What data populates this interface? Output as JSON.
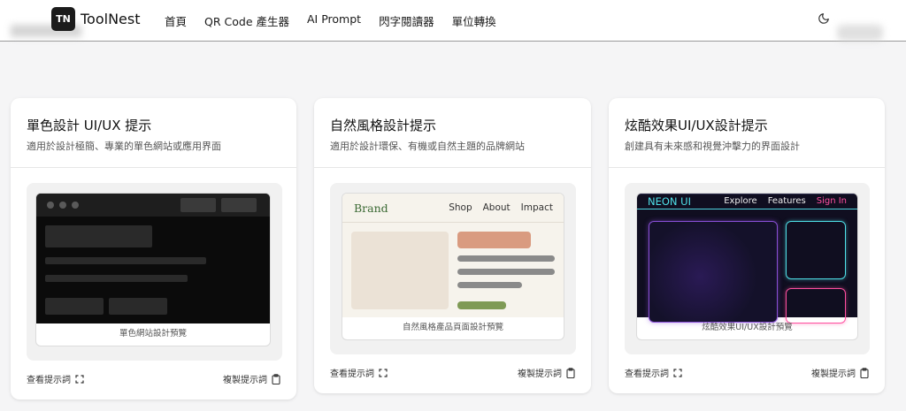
{
  "header": {
    "logo_initials": "TN",
    "app_name": "ToolNest",
    "nav": [
      "首頁",
      "QR Code 產生器",
      "AI Prompt",
      "閃字閱讀器",
      "單位轉換"
    ],
    "theme_icon": "moon-icon"
  },
  "cards": [
    {
      "title": "單色設計 UI/UX 提示",
      "description": "適用於設計極簡、專業的單色網站或應用界面",
      "preview_caption": "單色網站設計預覽",
      "view_label": "查看提示詞",
      "copy_label": "複製提示詞"
    },
    {
      "title": "自然風格設計提示",
      "description": "適用於設計環保、有機或自然主題的品牌網站",
      "preview_caption": "自然風格產品頁面設計預覽",
      "view_label": "查看提示詞",
      "copy_label": "複製提示詞",
      "preview": {
        "brand": "Brand",
        "links": [
          "Shop",
          "About",
          "Impact"
        ],
        "colors": {
          "bg": "#f6f3ec",
          "image": "#ebe2d6",
          "accent": "#d99b80",
          "line": "#8a8a8a",
          "button": "#7f9a55"
        }
      }
    },
    {
      "title": "炫酷效果UI/UX設計提示",
      "description": "創建具有未來感和視覺沖擊力的界面設計",
      "preview_caption": "炫酷效果UI/UX設計預覽",
      "view_label": "查看提示詞",
      "copy_label": "複製提示詞",
      "preview": {
        "brand": "NEON UI",
        "links": [
          "Explore",
          "Features",
          "Sign In"
        ],
        "colors": {
          "bg": "#100e20",
          "cyan": "#4fe0e8",
          "magenta": "#ff4fa0",
          "purple": "#8a4fd8"
        }
      }
    }
  ]
}
